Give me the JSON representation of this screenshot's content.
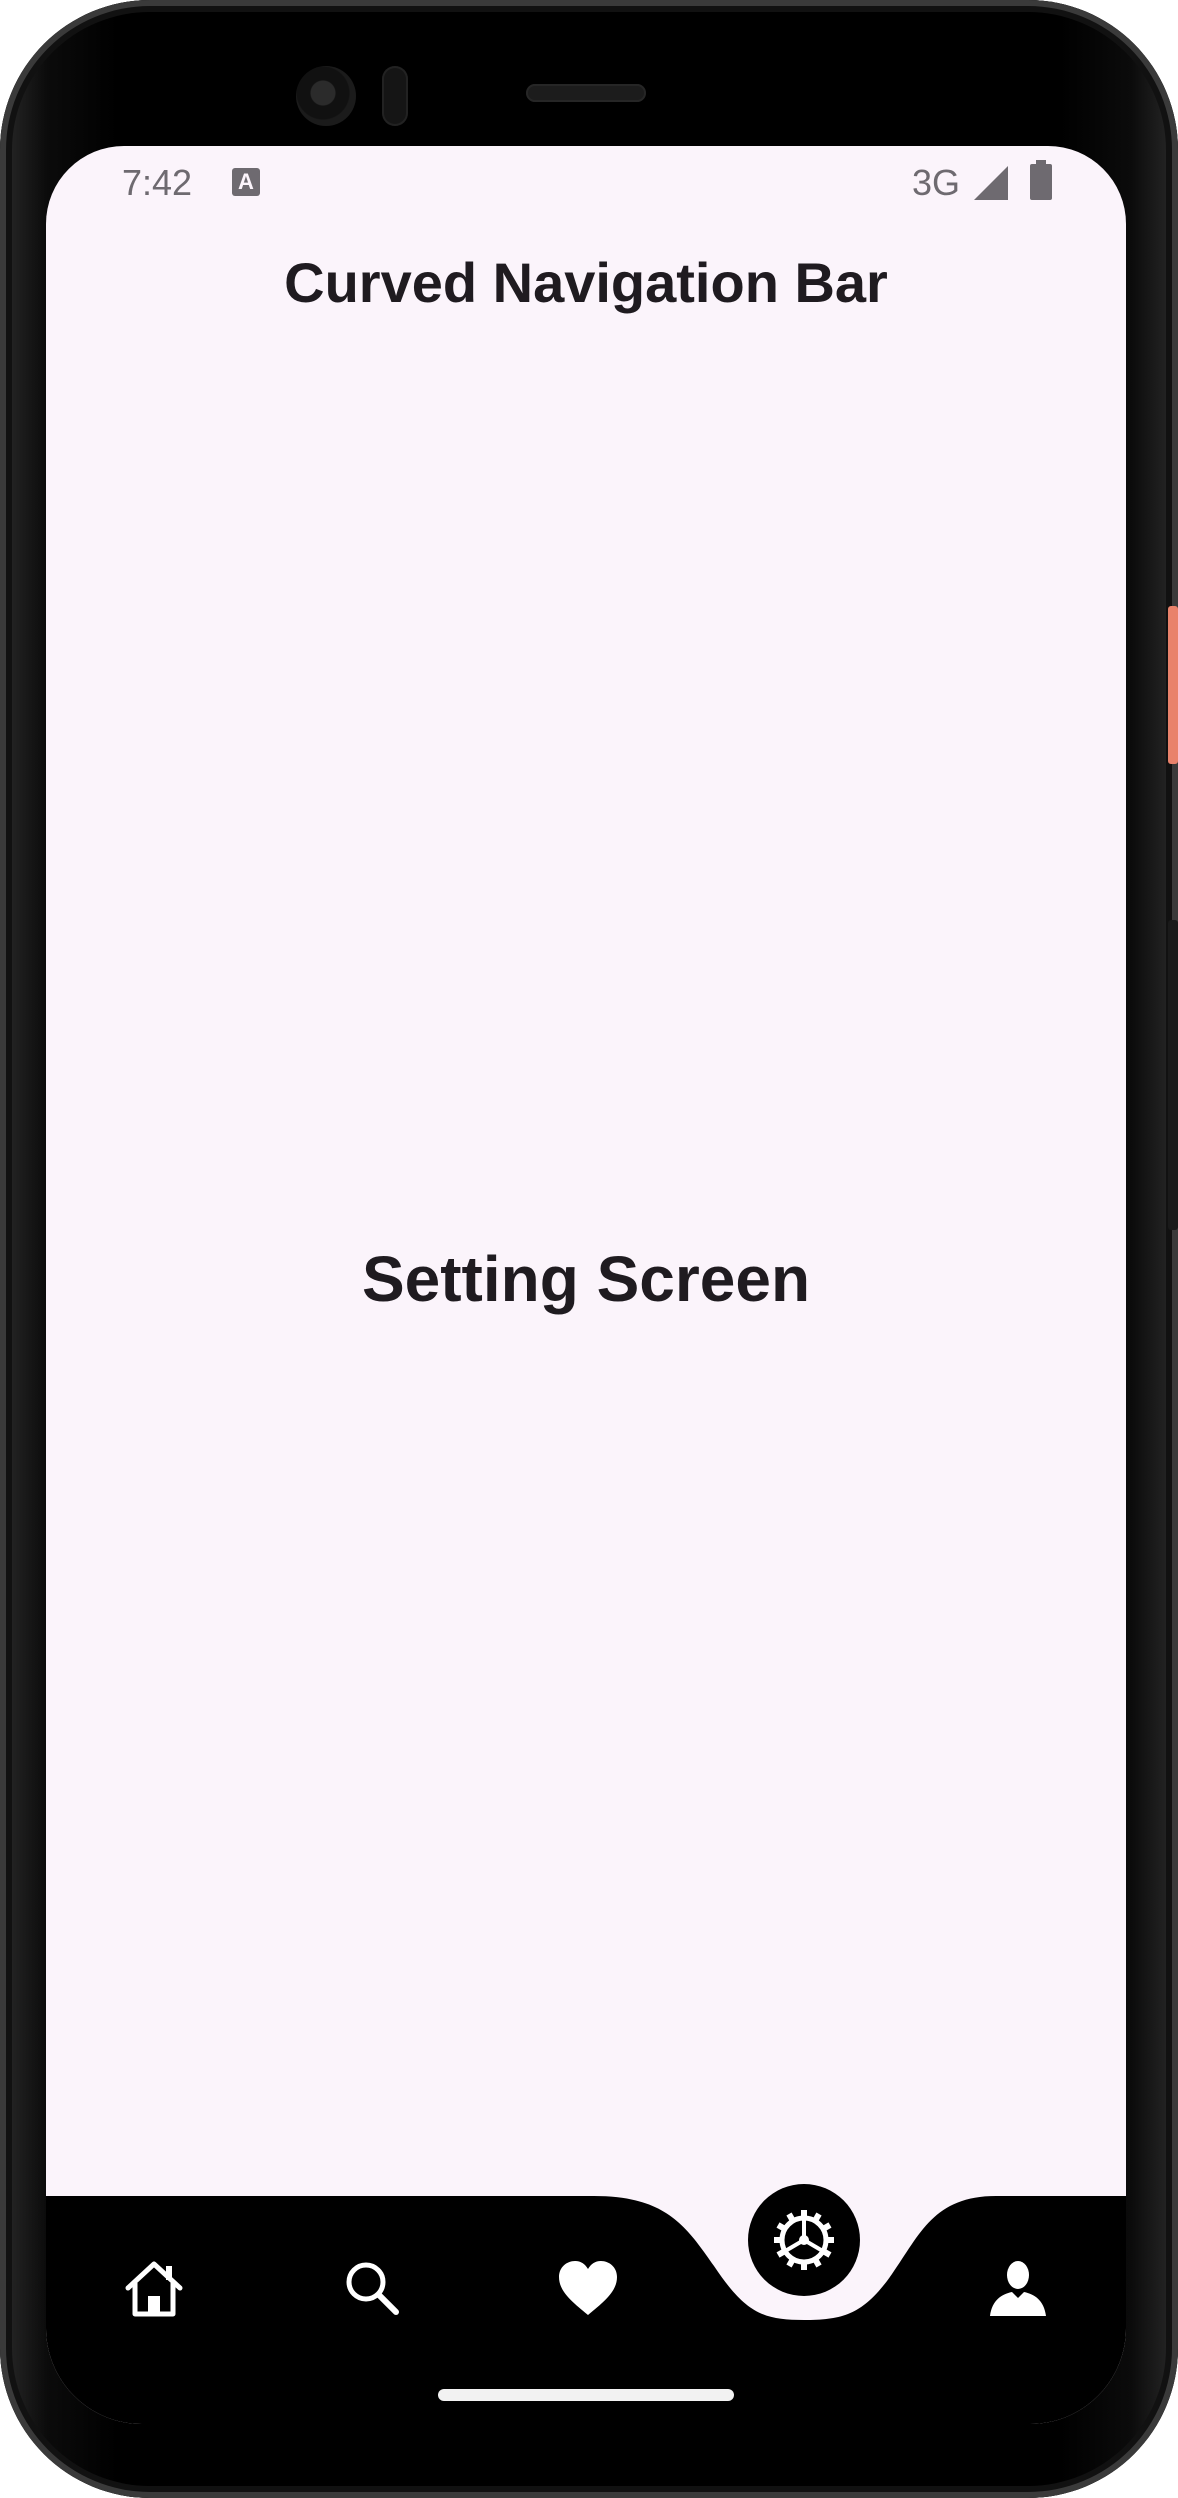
{
  "status_bar": {
    "time": "7:42",
    "notification_icon": "keyboard-a-icon",
    "network": "3G",
    "signal_icon": "signal-icon",
    "battery_icon": "battery-icon"
  },
  "app_bar": {
    "title": "Curved Navigation Bar"
  },
  "body": {
    "text": "Setting Screen"
  },
  "nav": {
    "items": [
      {
        "icon": "home-icon",
        "active": false
      },
      {
        "icon": "search-icon",
        "active": false
      },
      {
        "icon": "heart-icon",
        "active": false
      },
      {
        "icon": "settings-icon",
        "active": true
      },
      {
        "icon": "person-icon",
        "active": false
      }
    ],
    "bar_color": "#000000",
    "icon_color": "#ffffff"
  },
  "colors": {
    "screen_background": "#fbf4fb",
    "text": "#1f1b20",
    "status_text": "#6e6a70"
  }
}
